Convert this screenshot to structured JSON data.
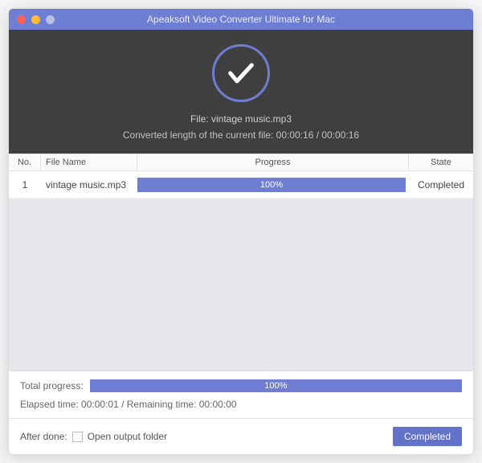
{
  "window": {
    "title": "Apeaksoft Video Converter Ultimate for Mac"
  },
  "status": {
    "file_label": "File: vintage music.mp3",
    "converted_line": "Converted length of the current file: 00:00:16 / 00:00:16"
  },
  "table": {
    "headers": {
      "no": "No.",
      "name": "File Name",
      "progress": "Progress",
      "state": "State"
    },
    "rows": [
      {
        "no": "1",
        "name": "vintage music.mp3",
        "progress_pct": "100%",
        "state": "Completed"
      }
    ]
  },
  "totals": {
    "label": "Total progress:",
    "pct": "100%",
    "time_line": "Elapsed time: 00:00:01 / Remaining time: 00:00:00"
  },
  "after": {
    "label": "After done:",
    "checkbox_label": "Open output folder",
    "button": "Completed"
  },
  "colors": {
    "accent": "#6e7ed2"
  }
}
